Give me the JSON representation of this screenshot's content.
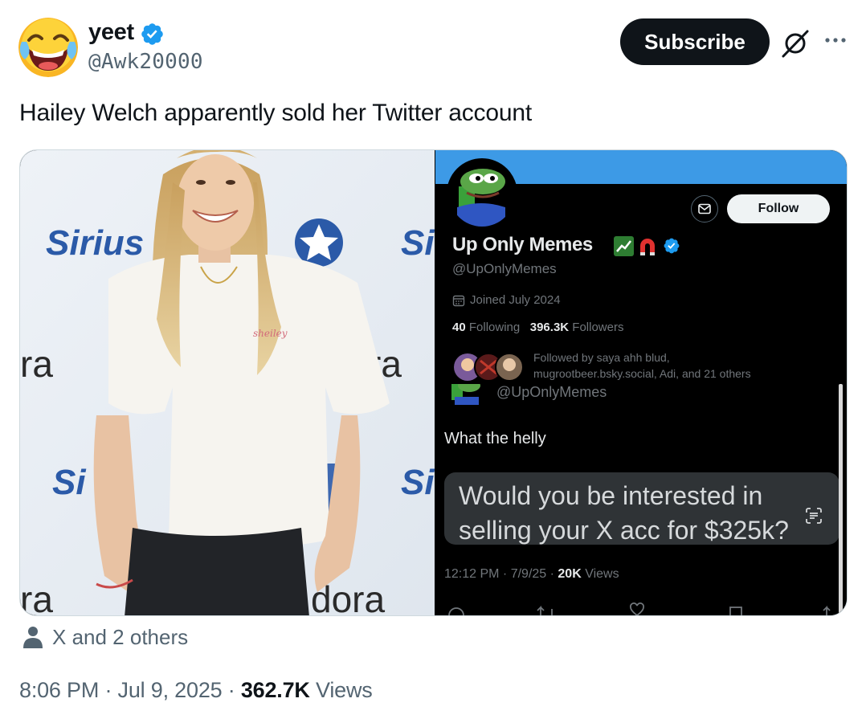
{
  "author": {
    "display_name": "yeet",
    "handle": "@Awk20000",
    "avatar_icon": "face-with-tears-of-joy-emoji",
    "verified_icon": "verified-badge-icon"
  },
  "actions": {
    "subscribe_label": "Subscribe"
  },
  "tweet": {
    "text": "Hailey Welch apparently sold her Twitter account"
  },
  "media": {
    "photo": {
      "backdrop_words": [
        "Sirius",
        "Si",
        "ra",
        "ra",
        "Si",
        "Si",
        "ra",
        "dora"
      ],
      "shirt_text": "sheiley"
    },
    "profile_card": {
      "name": "Up Only Memes",
      "handle": "@UpOnlyMemes",
      "joined": "Joined July 2024",
      "following_count": "40",
      "following_label": "Following",
      "followers_count": "396.3K",
      "followers_label": "Followers",
      "followed_by_line1": "Followed by saya ahh blud,",
      "followed_by_line2": "mugrootbeer.bsky.social, Adi, and 21 others",
      "follow_label": "Follow",
      "banner_color": "#3d9ae6"
    },
    "post_card": {
      "handle": "@UpOnlyMemes",
      "text": "What the helly",
      "bubble_line1": "Would you be interested in",
      "bubble_line2": "selling your X acc for $325k?",
      "time_date": "12:12 PM · 7/9/25 · ",
      "views_count": "20K",
      "views_label": "Views"
    }
  },
  "footer": {
    "tagged": "X and 2 others",
    "timestamp": "8:06 PM · Jul 9, 2025 · ",
    "views_count": "362.7K",
    "views_label": "Views"
  },
  "colors": {
    "accent": "#1d9bf0",
    "text_primary": "#0f1419",
    "text_secondary": "#536471"
  }
}
